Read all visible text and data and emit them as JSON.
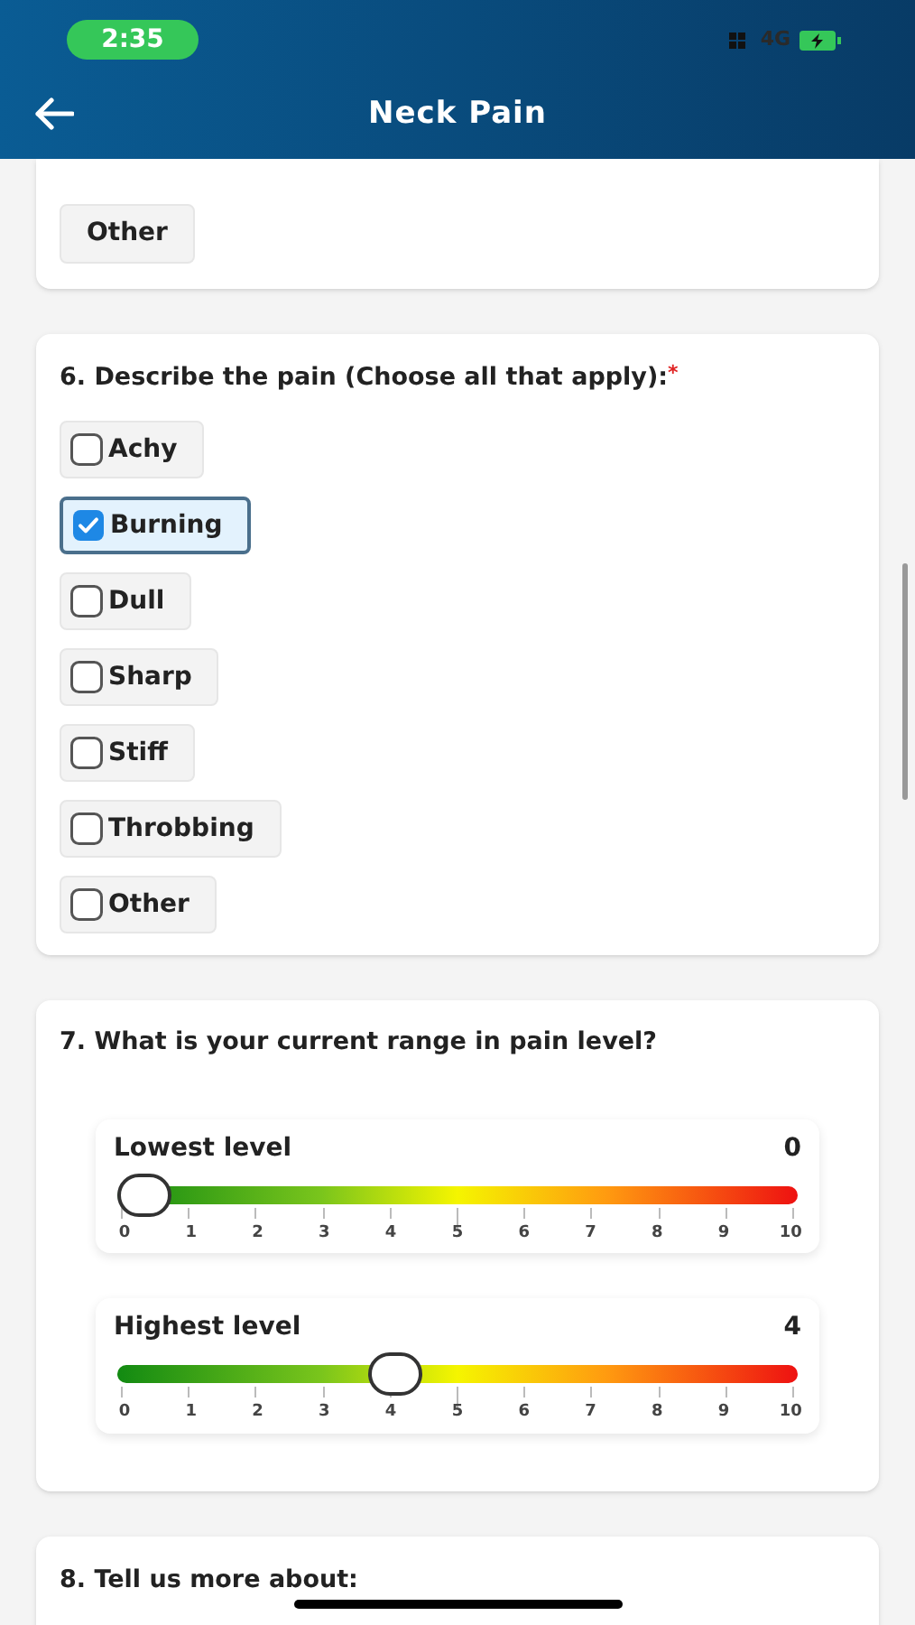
{
  "status_bar": {
    "time": "2:35",
    "network": "4G"
  },
  "header": {
    "title": "Neck Pain"
  },
  "q5": {
    "options": [
      {
        "label": "Other"
      }
    ]
  },
  "q6": {
    "question": "6. Describe the pain (Choose all that apply):",
    "required_mark": "*",
    "options": [
      {
        "label": "Achy",
        "checked": false
      },
      {
        "label": "Burning",
        "checked": true
      },
      {
        "label": "Dull",
        "checked": false
      },
      {
        "label": "Sharp",
        "checked": false
      },
      {
        "label": "Stiff",
        "checked": false
      },
      {
        "label": "Throbbing",
        "checked": false
      },
      {
        "label": "Other",
        "checked": false
      }
    ]
  },
  "q7": {
    "question": "7. What is your current range in pain level?",
    "sliders": [
      {
        "label": "Lowest level",
        "reading": "0",
        "level": 0,
        "ticks": [
          "0",
          "1",
          "2",
          "3",
          "4",
          "5",
          "6",
          "7",
          "8",
          "9",
          "10"
        ]
      },
      {
        "label": "Highest level",
        "reading": "4",
        "level": 0.4,
        "ticks": [
          "0",
          "1",
          "2",
          "3",
          "4",
          "5",
          "6",
          "7",
          "8",
          "9",
          "10"
        ]
      }
    ]
  },
  "q8": {
    "question": "8. Tell us more about:"
  }
}
